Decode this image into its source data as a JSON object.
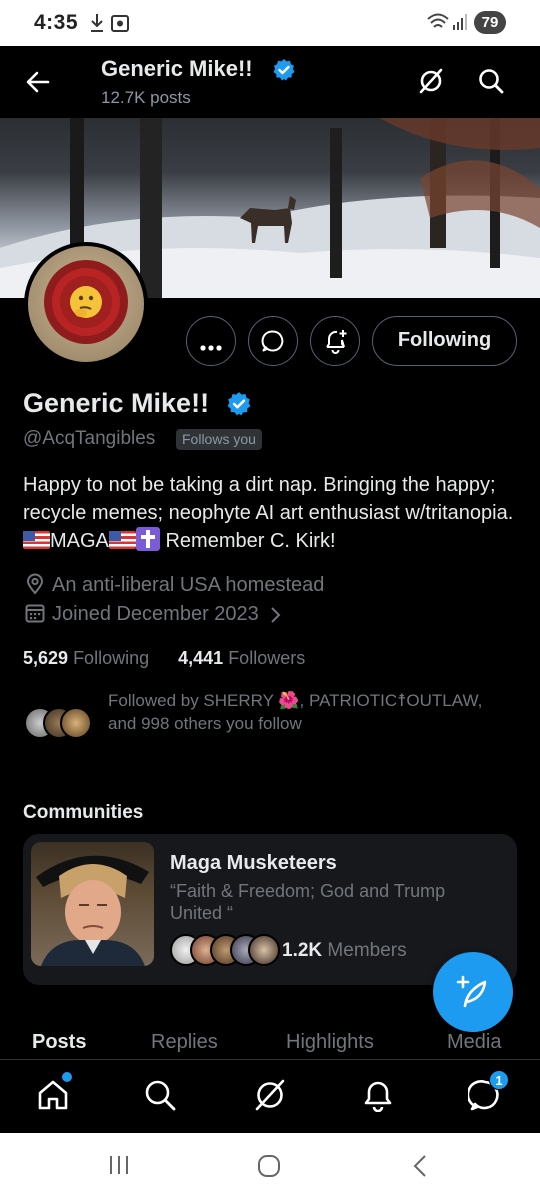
{
  "status_bar": {
    "time": "4:35",
    "battery": "79",
    "icons": [
      "download-icon",
      "screenshot-icon",
      "wifi-icon",
      "signal-icon"
    ]
  },
  "header": {
    "name": "Generic Mike!!",
    "posts": "12.7K posts",
    "icons": [
      "back-arrow-icon",
      "verified-badge-icon",
      "grok-icon",
      "search-icon"
    ]
  },
  "profile": {
    "name": "Generic Mike!!",
    "handle": "@AcqTangibles",
    "follows_you": "Follows you",
    "bio_line1": "Happy to not be taking a dirt nap. Bringing the happy; recycle memes; neophyte AI art enthusiast w/tritanopia.",
    "bio_maga": "MAGA",
    "bio_end": "Remember C. Kirk!",
    "location": "An anti-liberal USA homestead",
    "joined": "Joined December 2023",
    "following_count": "5,629",
    "following_label": "Following",
    "followers_count": "4,441",
    "followers_label": "Followers",
    "followed_by": "Followed by SHERRY 🌺, PATRIOTIC☨OUTLAW, and 998 others you follow"
  },
  "actions": {
    "following_button": "Following",
    "icons": [
      "more-icon",
      "message-icon",
      "notify-add-icon"
    ]
  },
  "communities": {
    "title": "Communities",
    "card": {
      "name": "Maga Musketeers",
      "description": "“Faith & Freedom; God and Trump United “",
      "member_count": "1.2K",
      "member_label": "Members"
    }
  },
  "tabs": [
    {
      "label": "Posts",
      "active": true
    },
    {
      "label": "Replies",
      "active": false
    },
    {
      "label": "Highlights",
      "active": false
    },
    {
      "label": "Media",
      "active": false
    }
  ],
  "bottom_nav": {
    "items": [
      "home-icon",
      "search-icon",
      "grok-icon",
      "notifications-icon",
      "messages-icon"
    ],
    "messages_badge": "1"
  },
  "colors": {
    "accent": "#1d9bf0",
    "background": "#000000",
    "text_primary": "#e7e9ea",
    "text_secondary": "#71767b"
  }
}
